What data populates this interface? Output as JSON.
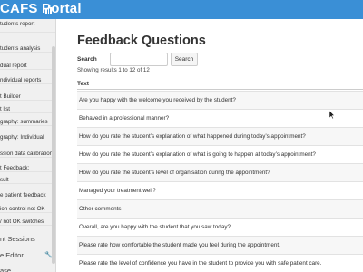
{
  "app": {
    "title": "CAFS Portal"
  },
  "sidebar": {
    "items": [
      {
        "label": "tudents report"
      },
      {
        "label": "tudents analysis"
      },
      {
        "label": "dual report"
      },
      {
        "label": "ndividual reports"
      },
      {
        "label": "t Builder"
      },
      {
        "label": "t list"
      },
      {
        "label": "graphy: summaries"
      },
      {
        "label": "graphy: Individual"
      },
      {
        "label": "ssion data calibration"
      },
      {
        "label": "t Feedback:"
      },
      {
        "label": "sult"
      },
      {
        "label": "e patient feedback"
      },
      {
        "label": "ion control not OK"
      },
      {
        "label": "/ not OK switches"
      }
    ],
    "sections": [
      {
        "label": "nt Sessions"
      },
      {
        "label": "e Editor"
      },
      {
        "label": "ase"
      }
    ]
  },
  "page": {
    "title": "Feedback Questions",
    "search_label": "Search",
    "search_value": "",
    "search_button": "Search",
    "results_text": "Showing results 1 to 12 of 12"
  },
  "table": {
    "header": "Text",
    "rows": [
      "Are you happy with the welcome you received by the student?",
      "Behaved in a professional manner?",
      "How do you rate the student’s explanation of what happened during today’s appointment?",
      "How do you rate the student’s explanation of what is going to happen at today’s appointment?",
      "How do you rate the student’s level of organisation during the appointment?",
      "Managed your treatment well?",
      "Other comments",
      "Overall, are you happy with the student that you saw today?",
      "Please rate how comfortable the student made you feel during the appointment.",
      "Please rate the level of confidence you have in the student to provide you with safe patient care."
    ]
  },
  "colors": {
    "topbar": "#3a8fd6",
    "sidebar": "#f0f0f0"
  },
  "icons": {
    "menu": "bars-chart-icon",
    "wrench": "wrench-icon"
  }
}
